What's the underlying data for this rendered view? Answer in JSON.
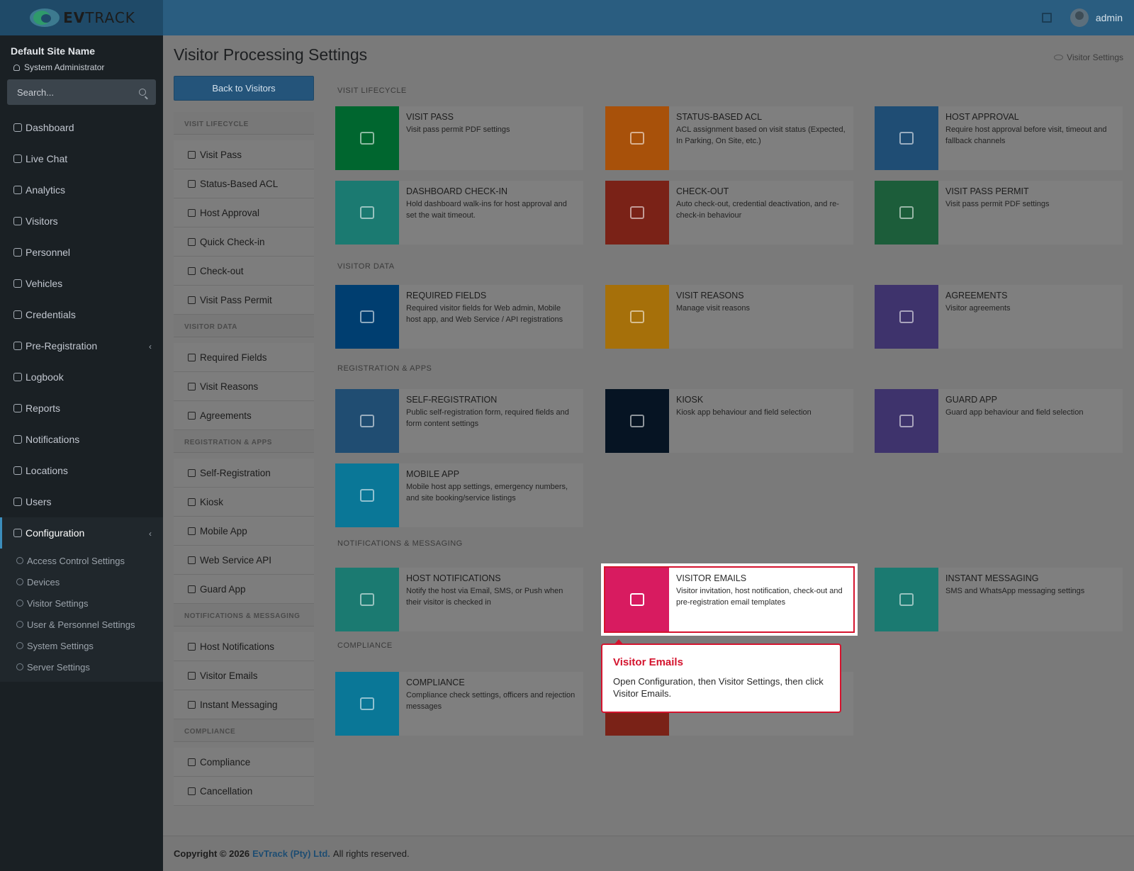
{
  "brand": {
    "name_bold": "EV",
    "name_rest": "TRACK"
  },
  "header": {
    "user": "admin"
  },
  "sidebar": {
    "site_name": "Default Site Name",
    "role": "System Administrator",
    "search_placeholder": "Search...",
    "items": [
      {
        "label": "Dashboard"
      },
      {
        "label": "Live Chat"
      },
      {
        "label": "Analytics"
      },
      {
        "label": "Visitors"
      },
      {
        "label": "Personnel"
      },
      {
        "label": "Vehicles"
      },
      {
        "label": "Credentials"
      },
      {
        "label": "Pre-Registration"
      },
      {
        "label": "Logbook"
      },
      {
        "label": "Reports"
      },
      {
        "label": "Notifications"
      },
      {
        "label": "Locations"
      },
      {
        "label": "Users"
      },
      {
        "label": "Configuration"
      }
    ],
    "sub_items": [
      {
        "label": "Access Control Settings"
      },
      {
        "label": "Devices"
      },
      {
        "label": "Visitor Settings"
      },
      {
        "label": "User & Personnel Settings"
      },
      {
        "label": "System Settings"
      },
      {
        "label": "Server Settings"
      }
    ]
  },
  "page": {
    "title": "Visitor Processing Settings",
    "breadcrumb": "Visitor Settings",
    "back_label": "Back to Visitors"
  },
  "left_list": {
    "groups": [
      {
        "label": "VISIT LIFECYCLE",
        "items": [
          "Visit Pass",
          "Status-Based ACL",
          "Host Approval",
          "Quick Check-in",
          "Check-out",
          "Visit Pass Permit"
        ]
      },
      {
        "label": "VISITOR DATA",
        "items": [
          "Required Fields",
          "Visit Reasons",
          "Agreements"
        ]
      },
      {
        "label": "REGISTRATION & APPS",
        "items": [
          "Self-Registration",
          "Kiosk",
          "Mobile App",
          "Web Service API",
          "Guard App"
        ]
      },
      {
        "label": "NOTIFICATIONS & MESSAGING",
        "items": [
          "Host Notifications",
          "Visitor Emails",
          "Instant Messaging"
        ]
      },
      {
        "label": "COMPLIANCE",
        "items": [
          "Compliance",
          "Cancellation"
        ]
      }
    ]
  },
  "sections": {
    "visit_lifecycle": "VISIT LIFECYCLE",
    "visitor_data": "VISITOR DATA",
    "registration_apps": "REGISTRATION & APPS",
    "notifications_messaging": "NOTIFICATIONS & MESSAGING",
    "compliance": "COMPLIANCE"
  },
  "cards": {
    "visit_pass": {
      "title": "VISIT PASS",
      "desc": "Visit pass permit PDF settings",
      "color": "#00662f"
    },
    "status_acl": {
      "title": "STATUS-BASED ACL",
      "desc": "ACL assignment based on visit status (Expected, In Parking, On Site, etc.)",
      "color": "#a8510a"
    },
    "host_approval": {
      "title": "HOST APPROVAL",
      "desc": "Require host approval before visit, timeout and fallback channels",
      "color": "#1f4d74"
    },
    "dashboard_checkin": {
      "title": "DASHBOARD CHECK-IN",
      "desc": "Hold dashboard walk-ins for host approval and set the wait timeout.",
      "color": "#1b7a71"
    },
    "checkout": {
      "title": "CHECK-OUT",
      "desc": "Auto check-out, credential deactivation, and re-check-in behaviour",
      "color": "#7a2217"
    },
    "visit_pass_permit": {
      "title": "VISIT PASS PERMIT",
      "desc": "Visit pass permit PDF settings",
      "color": "#1c5d3a"
    },
    "required_fields": {
      "title": "REQUIRED FIELDS",
      "desc": "Required visitor fields for Web admin, Mobile host app, and Web Service / API registrations",
      "color": "#003e70"
    },
    "visit_reasons": {
      "title": "VISIT REASONS",
      "desc": "Manage visit reasons",
      "color": "#a6700a"
    },
    "agreements": {
      "title": "AGREEMENTS",
      "desc": "Visitor agreements",
      "color": "#3e336c"
    },
    "self_registration": {
      "title": "SELF-REGISTRATION",
      "desc": "Public self-registration form, required fields and form content settings",
      "color": "#204d72"
    },
    "kiosk": {
      "title": "KIOSK",
      "desc": "Kiosk app behaviour and field selection",
      "color": "#061423"
    },
    "guard_app": {
      "title": "GUARD APP",
      "desc": "Guard app behaviour and field selection",
      "color": "#3e336c"
    },
    "mobile_app": {
      "title": "MOBILE APP",
      "desc": "Mobile host app settings, emergency numbers, and site booking/service listings",
      "color": "#0a7797"
    },
    "host_notifications": {
      "title": "HOST NOTIFICATIONS",
      "desc": "Notify the host via Email, SMS, or Push when their visitor is checked in",
      "color": "#1b7a71"
    },
    "visitor_emails": {
      "title": "VISITOR EMAILS",
      "desc": "Visitor invitation, host notification, check-out and pre-registration email templates",
      "color": "#d81b60"
    },
    "instant_messaging": {
      "title": "INSTANT MESSAGING",
      "desc": "SMS and WhatsApp messaging settings",
      "color": "#1b7a71"
    },
    "compliance": {
      "title": "COMPLIANCE",
      "desc": "Compliance check settings, officers and rejection messages",
      "color": "#0a7797"
    },
    "cancellation": {
      "title": "",
      "desc": "",
      "color": "#7a2217"
    }
  },
  "tooltip": {
    "title": "Visitor Emails",
    "body": "Open Configuration, then Visitor Settings, then click Visitor Emails."
  },
  "footer": {
    "copyright": "Copyright © 2026",
    "company": "EvTrack (Pty) Ltd.",
    "rights": "All rights reserved."
  }
}
